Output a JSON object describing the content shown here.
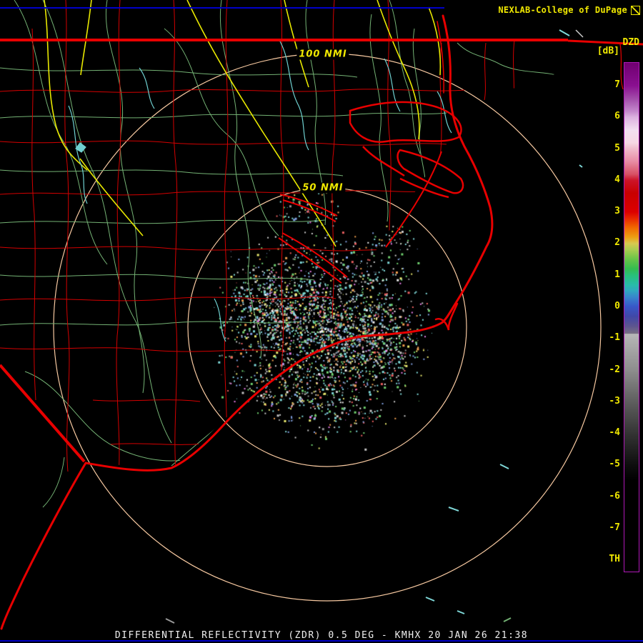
{
  "header": {
    "brand": "NEXLAB-College of DuPage"
  },
  "colorbar": {
    "title": "DZD",
    "units": "[dB]",
    "ticks": [
      "7",
      "6",
      "5",
      "4",
      "3",
      "2",
      "1",
      "0",
      "-1",
      "-2",
      "-3",
      "-4",
      "-5",
      "-6",
      "-7"
    ],
    "threshold_label": "TH",
    "border_color": "#b018b8",
    "label_color": "#f0e800",
    "gradient": [
      {
        "pos": 0.0,
        "color": "#700070"
      },
      {
        "pos": 0.045,
        "color": "#8a1090"
      },
      {
        "pos": 0.07,
        "color": "#a24caa"
      },
      {
        "pos": 0.095,
        "color": "#c488cc"
      },
      {
        "pos": 0.107,
        "color": "#dcb2e0"
      },
      {
        "pos": 0.132,
        "color": "#f2dff0"
      },
      {
        "pos": 0.157,
        "color": "#f6d8e4"
      },
      {
        "pos": 0.169,
        "color": "#f0bccc"
      },
      {
        "pos": 0.194,
        "color": "#e88ca4"
      },
      {
        "pos": 0.219,
        "color": "#d85064"
      },
      {
        "pos": 0.231,
        "color": "#cc1428"
      },
      {
        "pos": 0.256,
        "color": "#c80000"
      },
      {
        "pos": 0.293,
        "color": "#dc0000"
      },
      {
        "pos": 0.306,
        "color": "#e82800"
      },
      {
        "pos": 0.324,
        "color": "#f06800"
      },
      {
        "pos": 0.343,
        "color": "#eca014"
      },
      {
        "pos": 0.355,
        "color": "#d8c850"
      },
      {
        "pos": 0.368,
        "color": "#a8cc50"
      },
      {
        "pos": 0.386,
        "color": "#68c448"
      },
      {
        "pos": 0.405,
        "color": "#34bc50"
      },
      {
        "pos": 0.417,
        "color": "#28c078"
      },
      {
        "pos": 0.436,
        "color": "#28bca8"
      },
      {
        "pos": 0.448,
        "color": "#30a8c0"
      },
      {
        "pos": 0.461,
        "color": "#3884cc"
      },
      {
        "pos": 0.479,
        "color": "#3858c8"
      },
      {
        "pos": 0.498,
        "color": "#4048a8"
      },
      {
        "pos": 0.517,
        "color": "#5c5490"
      },
      {
        "pos": 0.532,
        "color": "#787084"
      },
      {
        "pos": 0.533,
        "color": "#b8b8b8"
      },
      {
        "pos": 0.541,
        "color": "#b2b2b2"
      },
      {
        "pos": 0.603,
        "color": "#8e8e8e"
      },
      {
        "pos": 0.666,
        "color": "#5e5e5e"
      },
      {
        "pos": 0.728,
        "color": "#343434"
      },
      {
        "pos": 0.79,
        "color": "#0e0e0e"
      },
      {
        "pos": 0.821,
        "color": "#000000"
      },
      {
        "pos": 1.0,
        "color": "#000000"
      }
    ]
  },
  "range_rings": {
    "outer_label": "100 NMI",
    "inner_label": "50 NMI",
    "ring_color": "#f6c8a0",
    "label_color": "#f0e800"
  },
  "caption": {
    "text": "DIFFERENTIAL REFLECTIVITY (ZDR) 0.5 DEG - KMHX 20 JAN 26 21:38"
  },
  "map_colors": {
    "background": "#000000",
    "county_border": "#d40000",
    "state_border": "#e80000",
    "coastline": "#e80000",
    "secondary_road": "#74b274",
    "primary_road": "#e8e800",
    "river": "#6fd0d0",
    "frame_rule": "#0000c8"
  },
  "radar_echoes": {
    "palette": [
      "#7fd8d8",
      "#c8c8c8",
      "#7f9fdf",
      "#6fcf6f",
      "#e8e86f",
      "#ef9f4f",
      "#e85f5f",
      "#e87fe8",
      "#f0f0f0",
      "#909090"
    ]
  }
}
